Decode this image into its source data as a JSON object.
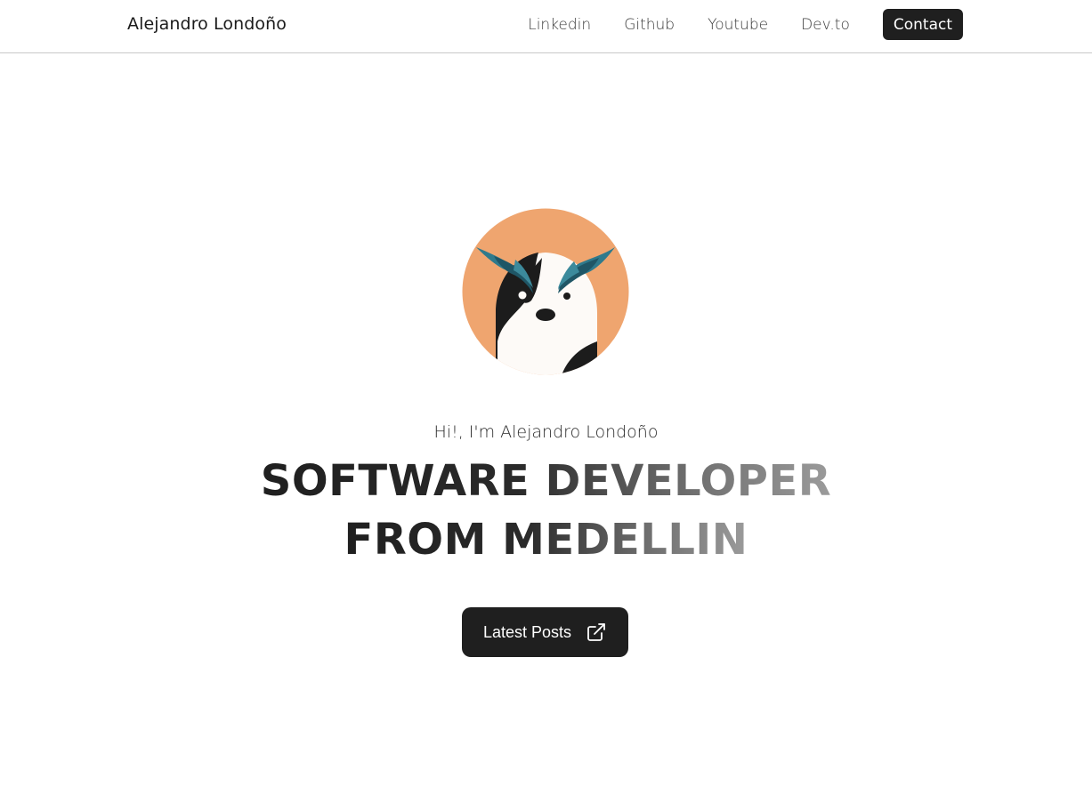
{
  "header": {
    "brand": "Alejandro Londoño",
    "nav": [
      {
        "label": "Linkedin"
      },
      {
        "label": "Github"
      },
      {
        "label": "Youtube"
      },
      {
        "label": "Dev.to"
      }
    ],
    "contact_label": "Contact"
  },
  "hero": {
    "avatar_icon": "cartoon-cow-avatar-icon",
    "greeting": "Hi!, I'm Alejandro Londoño",
    "headline_line1": "SOFTWARE DEVELOPER",
    "headline_line2": "FROM MEDELLIN",
    "cta_label": "Latest Posts",
    "cta_icon": "external-link-icon"
  },
  "colors": {
    "background": "#ffffff",
    "dark": "#1f1f1f",
    "avatar_bg": "#efa56f",
    "teal": "#2f7a8c"
  }
}
